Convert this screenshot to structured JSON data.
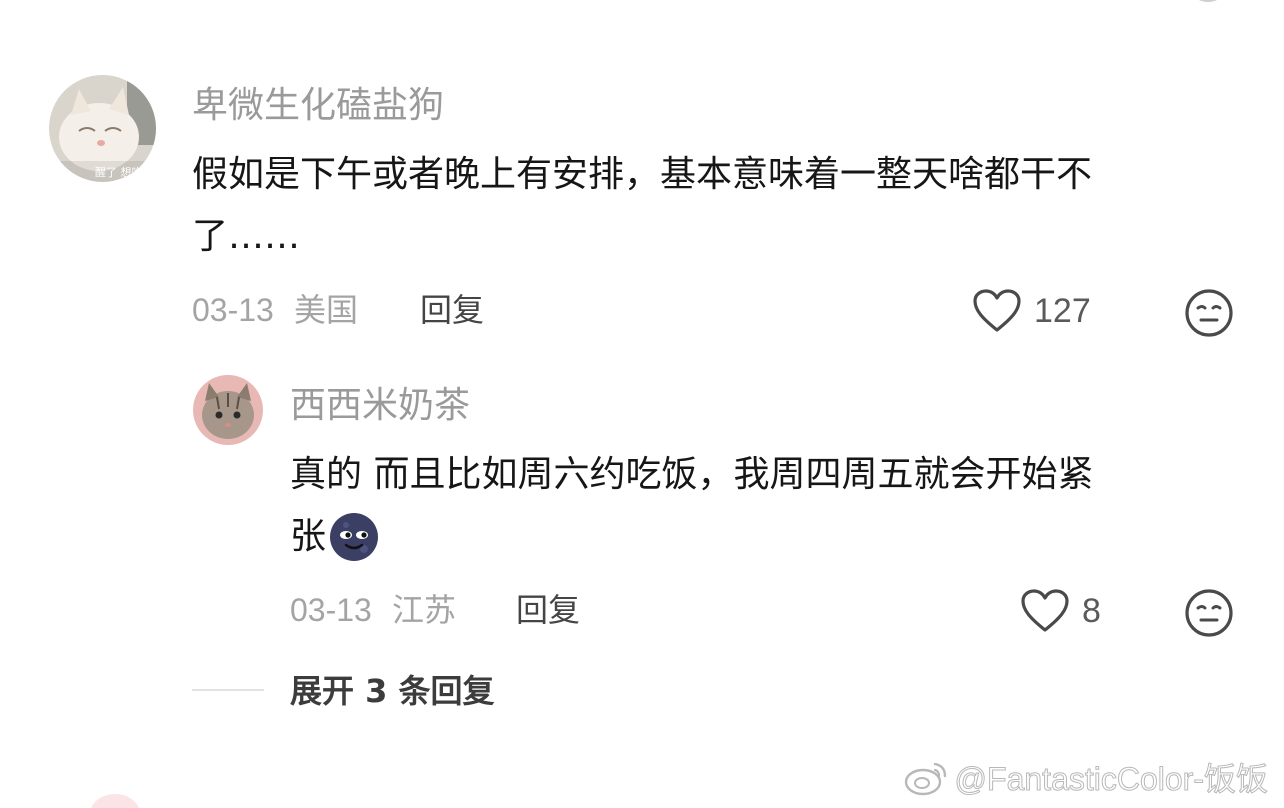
{
  "comment": {
    "username": "卑微生化磕盐狗",
    "avatar_caption": "醒了 想吃人",
    "text_line1": "假如是下午或者晚上有安排，基本意味着一整天啥都干不",
    "text_line2": "了……",
    "date": "03-13",
    "location": "美国",
    "reply_label": "回复",
    "likes": "127"
  },
  "reply": {
    "username": "西西米奶茶",
    "text_line1": "真的 而且比如周六约吃饭，我周四周五就会开始紧",
    "text_line2": "张",
    "date": "03-13",
    "location": "江苏",
    "reply_label": "回复",
    "likes": "8"
  },
  "expand_label": "展开 3 条回复",
  "watermark": "@FantasticColor-饭饭",
  "icons": {
    "like": "heart-outline-icon",
    "dislike": "neutral-face-icon",
    "emoji": "dark-moon-face-emoji",
    "watermark": "weibo-logo-icon"
  },
  "colors": {
    "username": "#9a9a9a",
    "text": "#161616",
    "meta": "#a4a4a4",
    "icon": "#4a4a4a"
  }
}
